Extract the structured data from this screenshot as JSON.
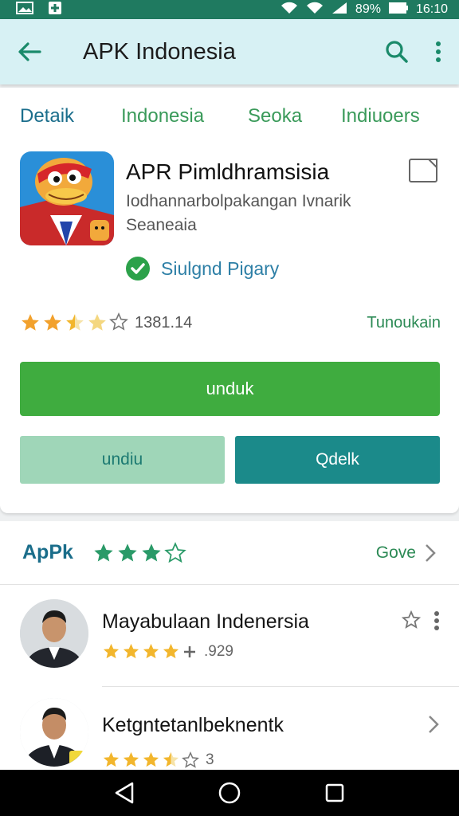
{
  "status_bar": {
    "battery": "89%",
    "time": "16:10"
  },
  "app_bar": {
    "title": "APK Indonesia"
  },
  "tabs": [
    "Detaik",
    "Indonesia",
    "Seoka",
    "Indiuoers"
  ],
  "app": {
    "name": "APR Pimldhramsisia",
    "description_line1": "Iodhannarbolpakangan Ivnarik",
    "description_line2": "Seaneaia",
    "verified_label": "Siulgnd Pigary",
    "rating_stars": 3.5,
    "rating_count": "1381.14",
    "rating_link": "Tunoukain"
  },
  "buttons": {
    "primary": "unduk",
    "secondary": "undiu",
    "tertiary": "Qdelk"
  },
  "section": {
    "title": "ApPk",
    "stars": 3,
    "link": "Gove"
  },
  "list_items": [
    {
      "title": "Mayabulaan Indenersia",
      "stars": 4,
      "count": ".929"
    },
    {
      "title": "Ketgntetanlbeknentk",
      "stars": 3.5,
      "count": "3"
    }
  ],
  "colors": {
    "status_bar": "#1f7a60",
    "app_bar": "#d7f1f4",
    "primary_button": "#3fac3f",
    "teal_button": "#1b8a8a",
    "star": "#f2b62d"
  }
}
